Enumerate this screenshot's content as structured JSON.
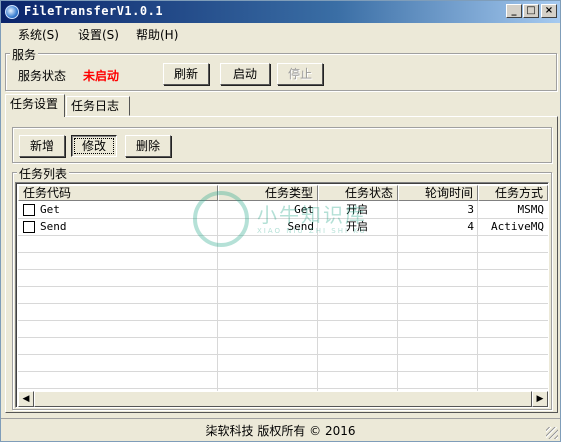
{
  "window": {
    "title": "FileTransferV1.0.1",
    "controls": {
      "minimize": "_",
      "maximize": "□",
      "close": "×"
    }
  },
  "menu": [
    "系统(S)",
    "设置(S)",
    "帮助(H)"
  ],
  "service": {
    "legend": "服务",
    "status_label": "服务状态",
    "status_value": "未启动",
    "status_color": "#ff0000",
    "buttons": {
      "refresh": "刷新",
      "start": "启动",
      "stop": "停止"
    }
  },
  "tabs": [
    "任务设置",
    "任务日志"
  ],
  "task_toolbar": {
    "add": "新增",
    "edit": "修改",
    "delete": "删除"
  },
  "task_list": {
    "legend": "任务列表",
    "columns": [
      "任务代码",
      "任务类型",
      "任务状态",
      "轮询时间",
      "任务方式"
    ],
    "rows": [
      {
        "code": "Get",
        "type": "Get",
        "status": "开启",
        "poll": "3",
        "mode": "MSMQ"
      },
      {
        "code": "Send",
        "type": "Send",
        "status": "开启",
        "poll": "4",
        "mode": "ActiveMQ"
      }
    ]
  },
  "statusbar": {
    "text": "柒软科技 版权所有 © 2016"
  },
  "watermark": {
    "text": "小牛知识库",
    "sub": "XIAO NIU ZHI SHI KU"
  }
}
